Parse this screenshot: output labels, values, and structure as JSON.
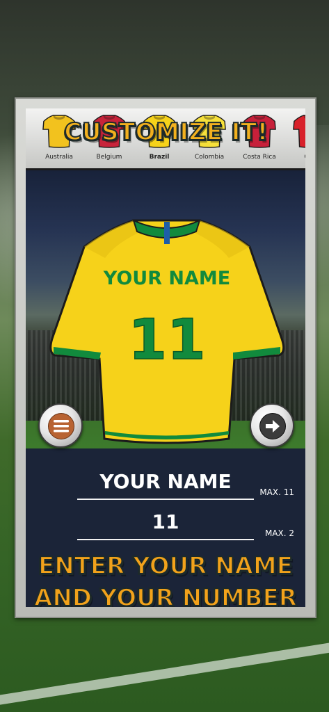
{
  "header": {
    "title": "CUSTOMIZE IT!"
  },
  "teams": [
    {
      "label": "Australia",
      "color": "#f2c21e",
      "active": false
    },
    {
      "label": "Belgium",
      "color": "#c8233a",
      "active": false
    },
    {
      "label": "Brazil",
      "color": "#f6d21a",
      "active": true
    },
    {
      "label": "Colombia",
      "color": "#f6e03a",
      "active": false
    },
    {
      "label": "Costa Rica",
      "color": "#c7203a",
      "active": false
    },
    {
      "label": "Cro",
      "color": "#d8202a",
      "active": false
    }
  ],
  "jersey": {
    "name": "YOUR NAME",
    "number": "11",
    "body_color": "#f6d21a",
    "trim_color": "#118a3d",
    "stripe_color": "#1d5ea8"
  },
  "buttons": {
    "menu_icon": "menu-icon",
    "next_icon": "arrow-right-icon"
  },
  "form": {
    "name_value": "YOUR NAME",
    "name_max": "MAX. 11",
    "number_value": "11",
    "number_max": "MAX. 2"
  },
  "footer": {
    "line1": "ENTER YOUR NAME",
    "line2": "AND YOUR NUMBER"
  }
}
